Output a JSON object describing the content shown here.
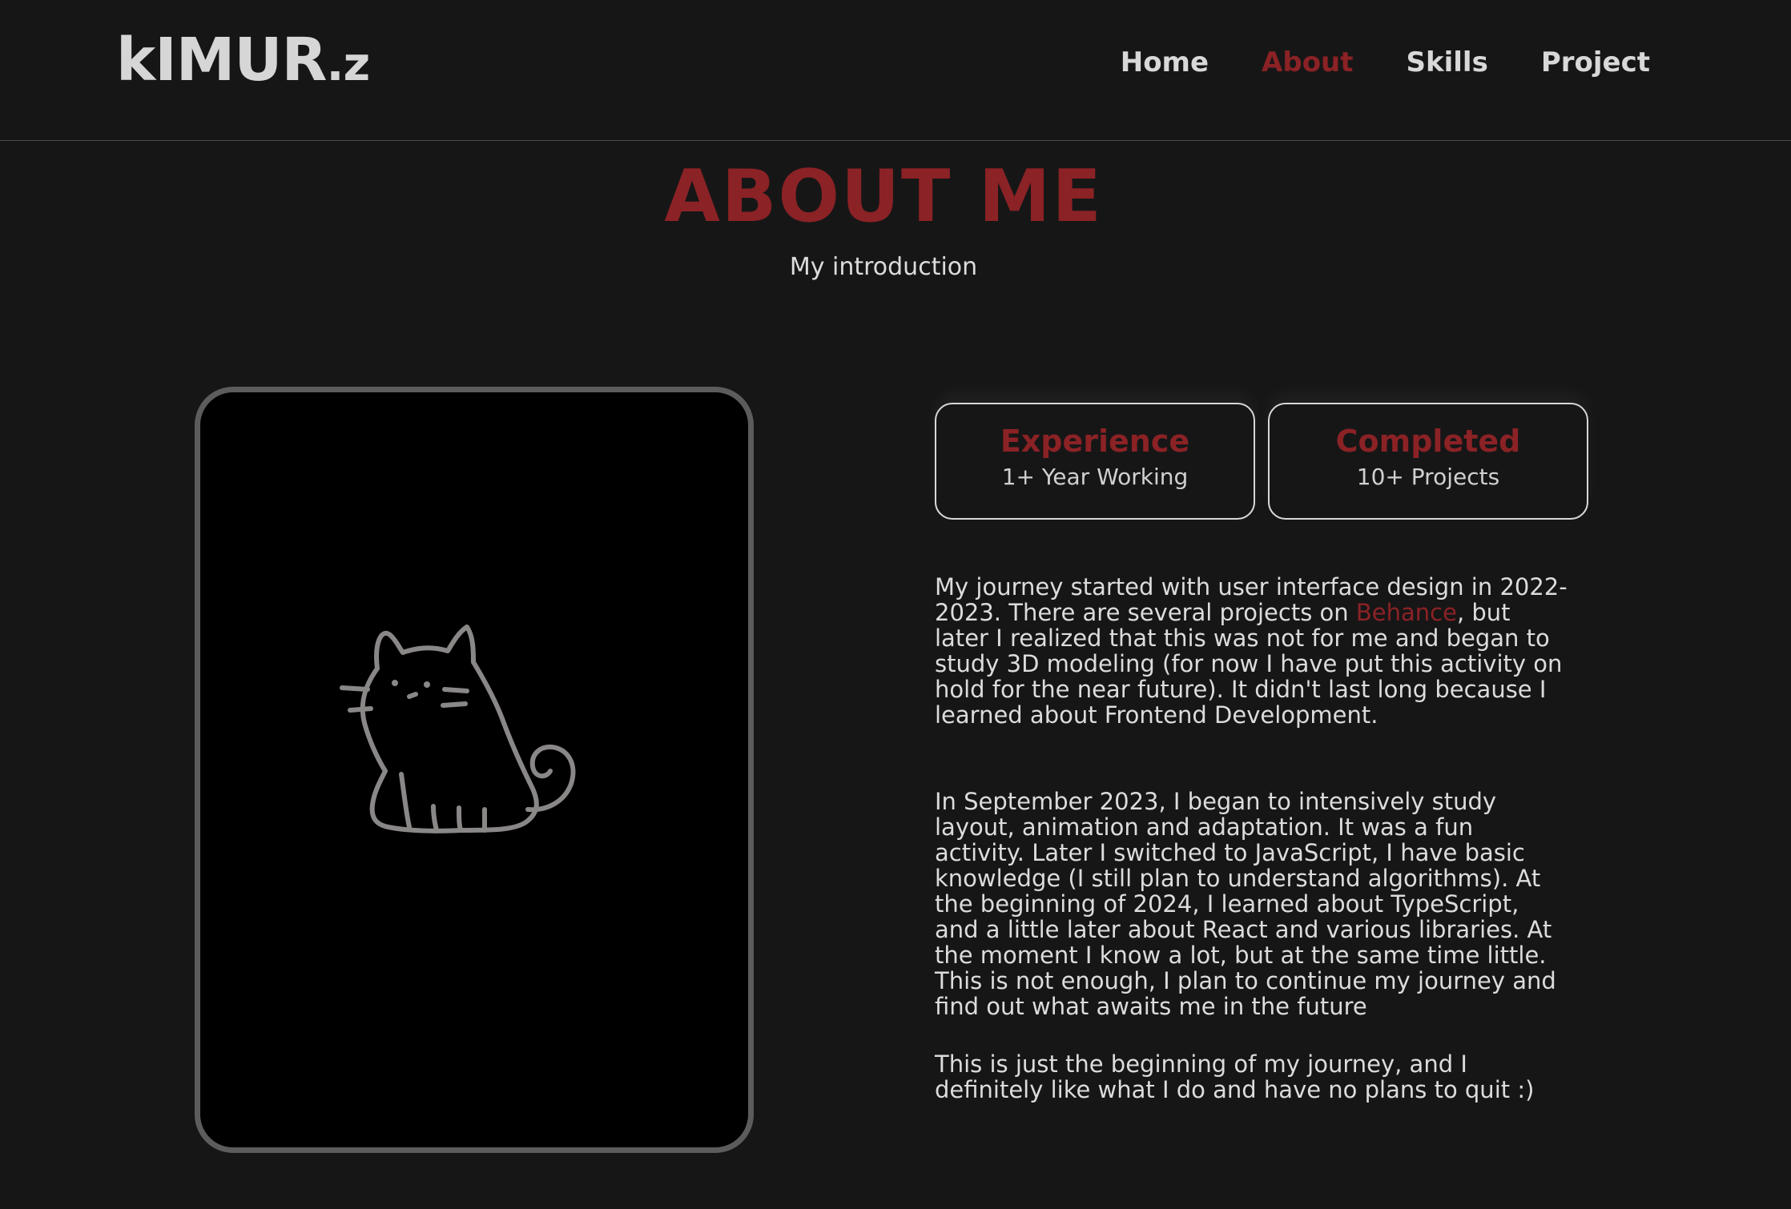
{
  "header": {
    "logo_main": "kIMUR",
    "logo_suffix": ".z",
    "nav": [
      {
        "label": "Home"
      },
      {
        "label": "About"
      },
      {
        "label": "Skills"
      },
      {
        "label": "Project"
      }
    ],
    "active": "About"
  },
  "section": {
    "title": "ABOUT ME",
    "subtitle": "My introduction"
  },
  "cards": [
    {
      "title": "Experience",
      "subtitle": "1+ Year Working"
    },
    {
      "title": "Completed",
      "subtitle": "10+ Projects"
    }
  ],
  "paragraphs": {
    "p1_before": "My journey started with user interface design in 2022-2023. There are several projects on ",
    "p1_link": "Behance",
    "p1_after": ", but later I realized that this was not for me and began to study 3D modeling (for now I have put this activity on hold for the near future). It didn't last long because I learned about Frontend Development.",
    "p2": "In September 2023, I began to intensively study layout, animation and adaptation. It was a fun activity. Later I switched to JavaScript, I have basic knowledge (I still plan to understand algorithms). At the beginning of 2024, I learned about TypeScript, and a little later about React and various libraries. At the moment I know a lot, but at the same time little. This is not enough, I plan to continue my journey and find out what awaits me in the future",
    "p3": "This is just the beginning of my journey, and I definitely like what I do and have no plans to quit :)"
  },
  "colors": {
    "background": "#171617",
    "accent": "#8b2225",
    "text": "#dcdcdc",
    "photo_border": "#5c5c5c"
  },
  "icons": {
    "photo": "cat-line-drawing"
  }
}
